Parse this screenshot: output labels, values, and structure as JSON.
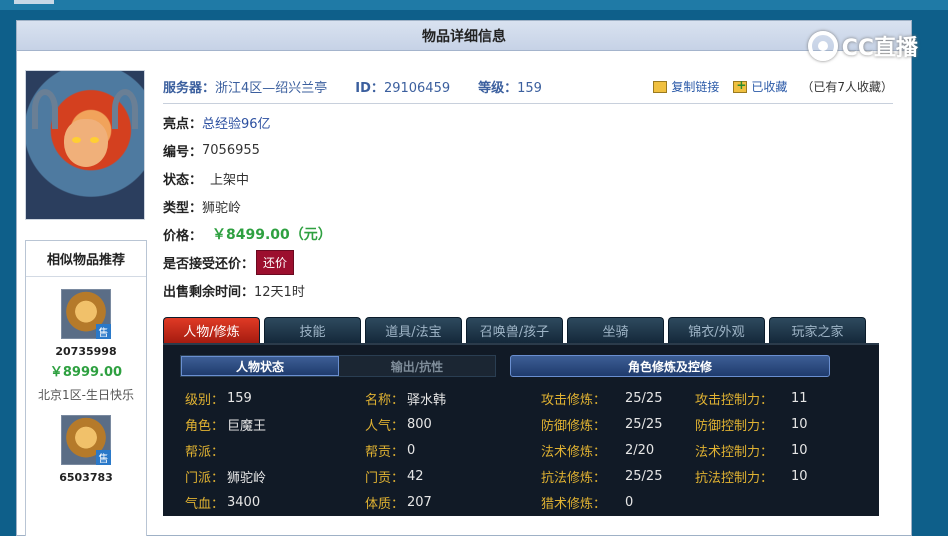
{
  "panel": {
    "title": "物品详细信息"
  },
  "watermark": {
    "text": "CC直播"
  },
  "similar": {
    "title": "相似物品推荐",
    "sell_badge": "售",
    "items": [
      {
        "id": "20735998",
        "price": "￥8999.00",
        "server": "北京1区-生日快乐"
      },
      {
        "id": "6503783"
      }
    ]
  },
  "info": {
    "server_label": "服务器：",
    "server_value": "浙江4区—绍兴兰亭",
    "id_label": "ID：",
    "id_value": "29106459",
    "level_label": "等级：",
    "level_value": "159",
    "copy_link": "复制链接",
    "favorited": "已收藏",
    "fav_count": "（已有7人收藏）",
    "highlight_label": "亮点：",
    "highlight_value": "总经验96亿",
    "serial_label": "编号：",
    "serial_value": "7056955",
    "status_label": "状态：",
    "status_value": "上架中",
    "type_label": "类型：",
    "type_value": "狮驼岭",
    "price_label": "价格：",
    "price_value": "￥8499.00（元）",
    "bargain_label": "是否接受还价：",
    "bargain_button": "还价",
    "remaining_label": "出售剩余时间：",
    "remaining_value": "12天1时"
  },
  "tabs": [
    "人物/修炼",
    "技能",
    "道具/法宝",
    "召唤兽/孩子",
    "坐骑",
    "锦衣/外观",
    "玩家之家"
  ],
  "game_panel": {
    "sub_tabs": [
      "人物状态",
      "输出/抗性"
    ],
    "cultivation_title": "角色修炼及控修",
    "left_stats": [
      {
        "label": "级别：",
        "value": "159"
      },
      {
        "label": "角色：",
        "value": "巨魔王"
      },
      {
        "label": "帮派：",
        "value": ""
      },
      {
        "label": "门派：",
        "value": "狮驼岭"
      },
      {
        "label": "气血：",
        "value": "3400"
      }
    ],
    "mid_stats": [
      {
        "label": "名称：",
        "value": "驿水韩"
      },
      {
        "label": "人气：",
        "value": "800"
      },
      {
        "label": "帮贡：",
        "value": "0"
      },
      {
        "label": "门贡：",
        "value": "42"
      },
      {
        "label": "体质：",
        "value": "207"
      }
    ],
    "cultivation": [
      {
        "label": "攻击修炼：",
        "value": "25/25"
      },
      {
        "label": "防御修炼：",
        "value": "25/25"
      },
      {
        "label": "法术修炼：",
        "value": "2/20"
      },
      {
        "label": "抗法修炼：",
        "value": "25/25"
      },
      {
        "label": "猎术修炼：",
        "value": "0"
      }
    ],
    "control": [
      {
        "label": "攻击控制力：",
        "value": "11"
      },
      {
        "label": "防御控制力：",
        "value": "10"
      },
      {
        "label": "法术控制力：",
        "value": "10"
      },
      {
        "label": "抗法控制力：",
        "value": "10"
      }
    ]
  }
}
